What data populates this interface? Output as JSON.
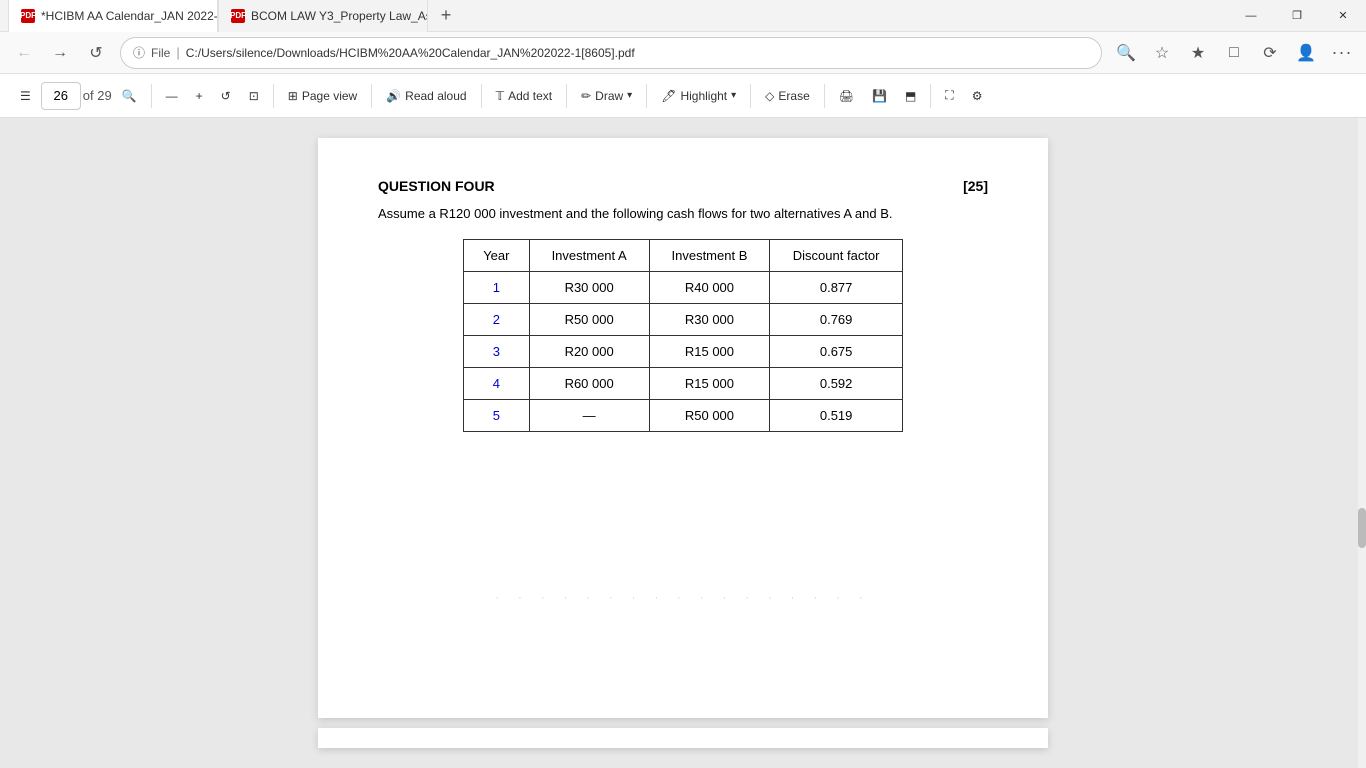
{
  "titlebar": {
    "tabs": [
      {
        "id": "tab1",
        "favicon": "PDF",
        "label": "*HCIBM AA Calendar_JAN 2022-",
        "active": true
      },
      {
        "id": "tab2",
        "favicon": "PDF",
        "label": "BCOM LAW Y3_Property Law_As",
        "active": false
      }
    ],
    "newtab_label": "+",
    "controls": {
      "minimize": "—",
      "restore": "❐",
      "close": "✕"
    }
  },
  "addrbar": {
    "back_label": "←",
    "forward_label": "→",
    "refresh_label": "↺",
    "url": "C:/Users/silence/Downloads/HCIBM%20AA%20Calendar_JAN%202022-1[8605].pdf",
    "search_icon": "🔍",
    "star_icon": "☆",
    "fav_icon": "★",
    "collections_icon": "□",
    "history_icon": "⟳",
    "profile_icon": "👤",
    "more_icon": "..."
  },
  "pdf_toolbar": {
    "menu_icon": "☰",
    "page_current": "26",
    "page_total": "of 29",
    "search_icon": "🔍",
    "zoom_out": "—",
    "zoom_in": "+",
    "rotate_label": "↺",
    "fit_label": "⊡",
    "sep": "|",
    "page_view_label": "Page view",
    "read_aloud_label": "Read aloud",
    "add_text_label": "Add text",
    "draw_label": "Draw",
    "highlight_label": "Highlight",
    "erase_label": "Erase",
    "print_label": "🖨",
    "save_label": "💾",
    "share_label": "⬒",
    "fullscreen_label": "⛶",
    "settings_label": "⚙"
  },
  "pdf_content": {
    "question_title": "QUESTION FOUR",
    "question_marks": "[25]",
    "intro": "Assume a R120 000 investment and the following cash flows for two alternatives A and B.",
    "table": {
      "headers": [
        "Year",
        "Investment A",
        "Investment B",
        "Discount factor"
      ],
      "rows": [
        {
          "year": "1",
          "inv_a": "R30 000",
          "inv_b": "R40 000",
          "discount": "0.877"
        },
        {
          "year": "2",
          "inv_a": "R50 000",
          "inv_b": "R30 000",
          "discount": "0.769"
        },
        {
          "year": "3",
          "inv_a": "R20 000",
          "inv_b": "R15 000",
          "discount": "0.675"
        },
        {
          "year": "4",
          "inv_a": "R60 000",
          "inv_b": "R15 000",
          "discount": "0.592"
        },
        {
          "year": "5",
          "inv_a": "—",
          "inv_b": "R50 000",
          "discount": "0.519"
        }
      ]
    }
  }
}
